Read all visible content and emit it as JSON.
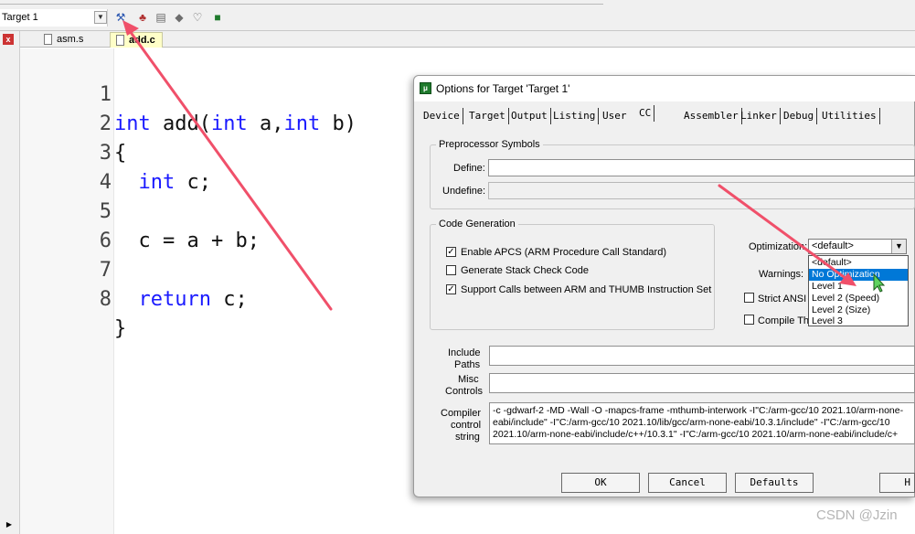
{
  "toolbar": {
    "target_value": "Target 1",
    "icons": [
      "dropdown-arrow-icon",
      "options-for-target-icon",
      "manage-components-icon",
      "copy-icon",
      "diamond-icon",
      "pack-icon",
      "green-package-icon"
    ]
  },
  "tabs": [
    {
      "label": "asm.s",
      "active": false
    },
    {
      "label": "add.c",
      "active": true
    }
  ],
  "editor": {
    "lines": [
      {
        "num": "1",
        "text": "int add(int a,int b)"
      },
      {
        "num": "2",
        "text": "{"
      },
      {
        "num": "3",
        "text": "  int c;"
      },
      {
        "num": "4",
        "text": ""
      },
      {
        "num": "5",
        "text": "  c = a + b;"
      },
      {
        "num": "6",
        "text": ""
      },
      {
        "num": "7",
        "text": "  return c;"
      },
      {
        "num": "8",
        "text": "}"
      }
    ]
  },
  "dialog": {
    "title": "Options for Target 'Target 1'",
    "tabs": [
      "Device",
      "Target",
      "Output",
      "Listing",
      "User",
      "CC",
      "Assembler",
      "Linker",
      "Debug",
      "Utilities"
    ],
    "active_tab": "CC",
    "preprocessor": {
      "legend": "Preprocessor Symbols",
      "define_label": "Define:",
      "define_value": "",
      "undefine_label": "Undefine:",
      "undefine_value": ""
    },
    "codegen": {
      "legend": "Code Generation",
      "apcs": {
        "label": "Enable APCS (ARM Procedure Call Standard)",
        "checked": true
      },
      "stack_check": {
        "label": "Generate Stack Check Code",
        "checked": false
      },
      "interwork": {
        "label": "Support Calls between ARM and THUMB Instruction Set",
        "checked": true
      }
    },
    "optimization": {
      "label": "Optimization:",
      "value": "<default>",
      "options": [
        "<default>",
        "No Optimization",
        "Level 1",
        "Level 2 (Speed)",
        "Level 2 (Size)",
        "Level 3"
      ],
      "highlighted": "No Optimization"
    },
    "warnings_label": "Warnings:",
    "strict_ansi": {
      "label": "Strict ANSI C",
      "checked": false
    },
    "compile_thumb": {
      "label": "Compile Thumb",
      "checked": false
    },
    "include_paths": {
      "label_1": "Include",
      "label_2": "Paths",
      "value": ""
    },
    "misc_controls": {
      "label_1": "Misc",
      "label_2": "Controls",
      "value": ""
    },
    "compiler_string": {
      "label_1": "Compiler",
      "label_2": "control",
      "label_3": "string",
      "line_1": "-c -gdwarf-2 -MD -Wall -O -mapcs-frame -mthumb-interwork -I\"C:/arm-gcc/10 2021.10/arm-none-",
      "line_2": "eabi/include\" -I\"C:/arm-gcc/10 2021.10/lib/gcc/arm-none-eabi/10.3.1/include\" -I\"C:/arm-gcc/10",
      "line_3": "2021.10/arm-none-eabi/include/c++/10.3.1\" -I\"C:/arm-gcc/10 2021.10/arm-none-eabi/include/c+"
    },
    "buttons": {
      "ok": "OK",
      "cancel": "Cancel",
      "defaults": "Defaults",
      "help": "H"
    }
  },
  "watermark": "CSDN @Jzin",
  "colors": {
    "arrow": "#f0506a",
    "keyword": "#1a1aff",
    "selection": "#0078d7"
  }
}
